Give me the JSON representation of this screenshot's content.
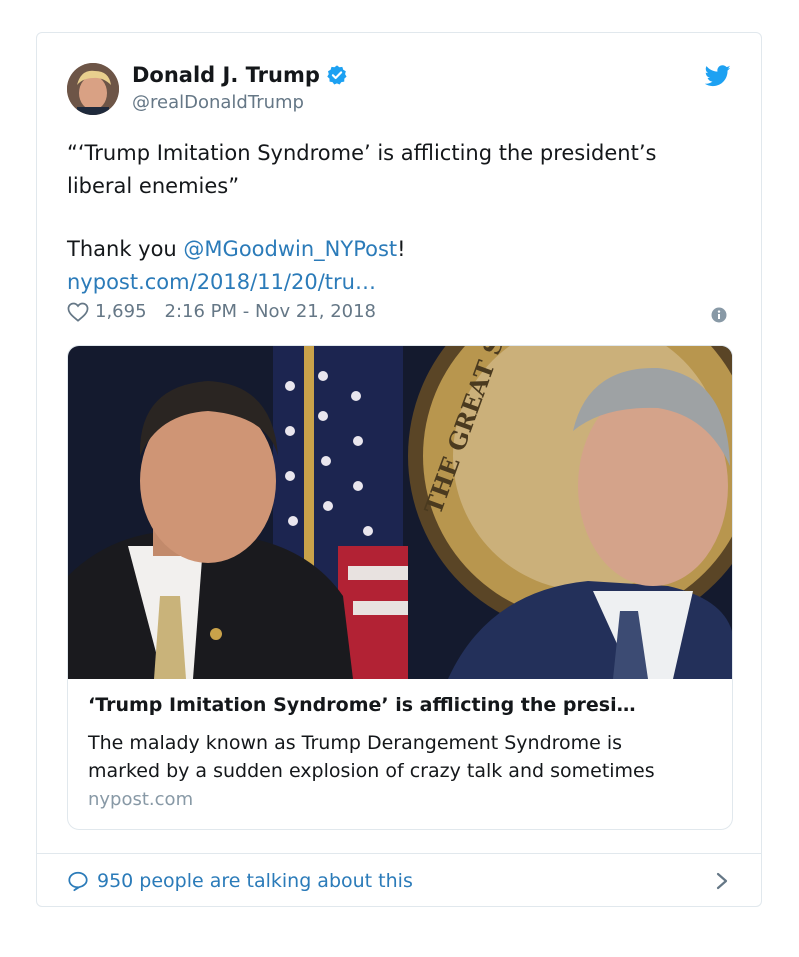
{
  "tweet": {
    "author": {
      "name": "Donald J. Trump",
      "handle": "@realDonaldTrump",
      "verified": true
    },
    "text": {
      "line1": "“‘Trump Imitation Syndrome’ is afflicting the president’s",
      "line2": "liberal enemies”",
      "thanks_prefix": "Thank you ",
      "mention": "@MGoodwin_NYPost",
      "thanks_suffix": "!",
      "url": "nypost.com/2018/11/20/tru…"
    },
    "likes": "1,695",
    "timestamp": "2:16 PM - Nov 21, 2018",
    "card": {
      "title": "‘Trump Imitation Syndrome’ is afflicting the presi…",
      "description_line1": "The malady known as Trump Derangement Syndrome is",
      "description_line2": "marked by a sudden explosion of crazy talk and sometimes",
      "domain": "nypost.com"
    },
    "footer": {
      "talking": "950 people are talking about this"
    }
  },
  "icons": {
    "verified": "verified-badge-icon",
    "bird": "twitter-bird-icon",
    "heart": "heart-icon",
    "info": "info-icon",
    "bubble": "speech-bubble-icon",
    "chevron": "chevron-right-icon"
  },
  "colors": {
    "link": "#2b7bb9",
    "verified": "#1da1f2",
    "muted": "#657786",
    "border": "#e1e8ed"
  }
}
